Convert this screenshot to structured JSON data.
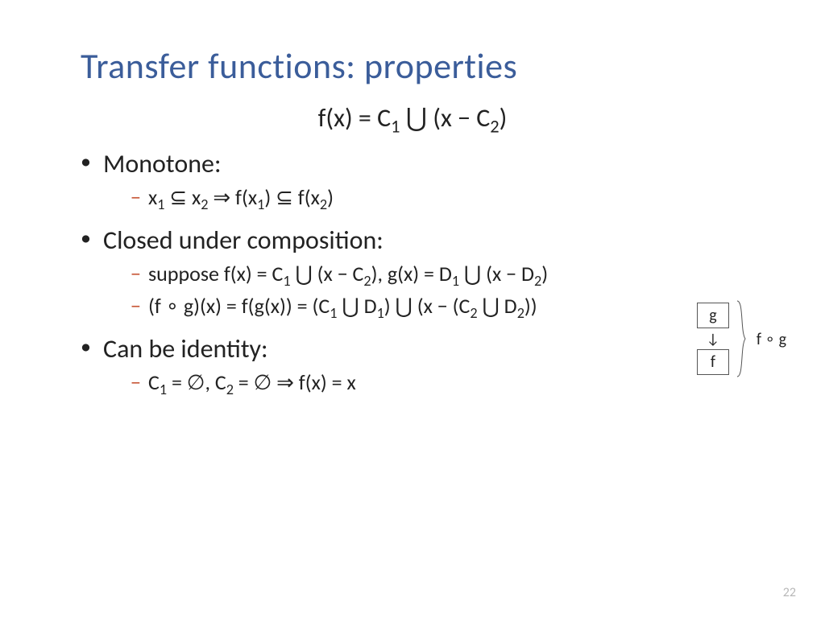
{
  "title": "Transfer functions: properties",
  "formula_html": "f(x) = C<sub>1</sub> ⋃ (x − C<sub>2</sub>)",
  "bullets": [
    {
      "label": "Monotone:",
      "subs": [
        "x<sub>1</sub> ⊆ x<sub>2</sub> ⇒ f(x<sub>1</sub>) ⊆ f(x<sub>2</sub>)"
      ]
    },
    {
      "label": "Closed under composition:",
      "subs": [
        "suppose f(x) = C<sub>1</sub> ⋃ (x − C<sub>2</sub>), g(x) = D<sub>1</sub> ⋃ (x − D<sub>2</sub>)",
        "(f ∘ g)(x) = f(g(x)) = (C<sub>1</sub> ⋃ D<sub>1</sub>) ⋃ (x − (C<sub>2</sub> ⋃ D<sub>2</sub>))"
      ]
    },
    {
      "label": "Can be identity:",
      "subs": [
        "C<sub>1</sub> = ∅, C<sub>2</sub> = ∅ ⇒ f(x) = x"
      ]
    }
  ],
  "diagram": {
    "top_box": "g",
    "bottom_box": "f",
    "brace_label": "f ∘ g"
  },
  "page_number": "22"
}
